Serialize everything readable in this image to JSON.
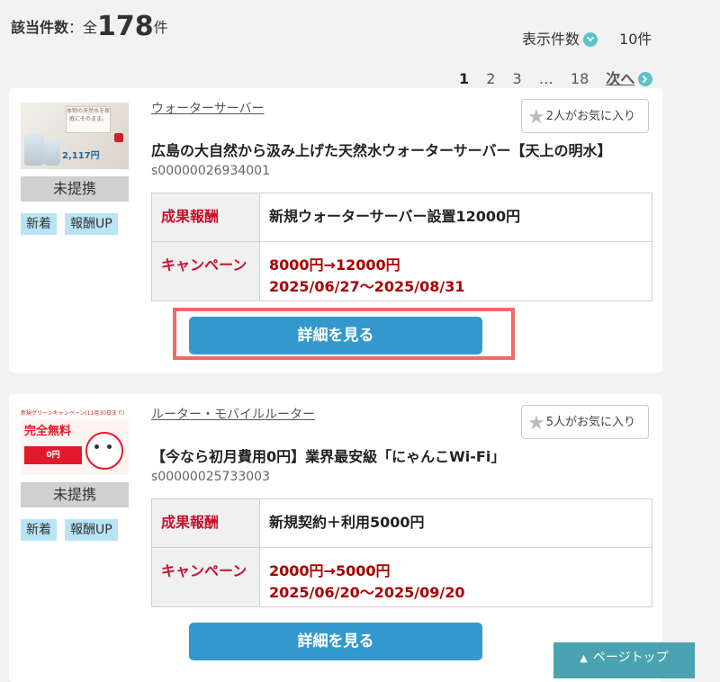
{
  "summary": {
    "label": "該当件数",
    "sep": "：全",
    "count": "178",
    "unit": "件"
  },
  "per_page": {
    "label": "表示件数",
    "value": "10件"
  },
  "pagination": {
    "pages": [
      "1",
      "2",
      "3",
      "…",
      "18"
    ],
    "current": "1",
    "next": "次へ"
  },
  "items": [
    {
      "thumb": {
        "text": "本物の天然水を家庭にそのまま。",
        "price": "2,117円"
      },
      "status": "未提携",
      "tags": [
        "新着",
        "報酬UP"
      ],
      "category": "ウォーターサーバー",
      "favorites": "2人がお気に入り",
      "title": "広島の大自然から汲み上げた天然水ウォーターサーバー【天上の明水】",
      "code": "s00000026934001",
      "reward_label": "成果報酬",
      "reward": "新規ウォーターサーバー設置12000円",
      "campaign_label": "キャンペーン",
      "campaign_line1": "8000円→12000円",
      "campaign_line2": "2025/06/27～2025/08/31",
      "button": "詳細を見る"
    },
    {
      "thumb": {
        "topbar": "新規グリーンキャンペーン(11月30日まで)",
        "free": "完全無料",
        "zero": "0円"
      },
      "status": "未提携",
      "tags": [
        "新着",
        "報酬UP"
      ],
      "category": "ルーター・モバイルルーター",
      "favorites": "5人がお気に入り",
      "title": "【今なら初月費用0円】業界最安級「にゃんこWi-Fi」",
      "code": "s00000025733003",
      "reward_label": "成果報酬",
      "reward": "新規契約＋利用5000円",
      "campaign_label": "キャンペーン",
      "campaign_line1": "2000円→5000円",
      "campaign_line2": "2025/06/20～2025/09/20",
      "button": "詳細を見る"
    }
  ],
  "page_top": "ページトップ",
  "colors": {
    "accent": "#3399cc",
    "reward_label": "#c8102e",
    "campaign": "#aa0000",
    "highlight": "#ee6a6a",
    "tag_bg": "#b9e4f5",
    "page_top": "#4aa3b0"
  },
  "icons": {
    "star": "star-icon",
    "chevron": "chevron-icon",
    "arrow_up": "arrow-up-icon"
  }
}
